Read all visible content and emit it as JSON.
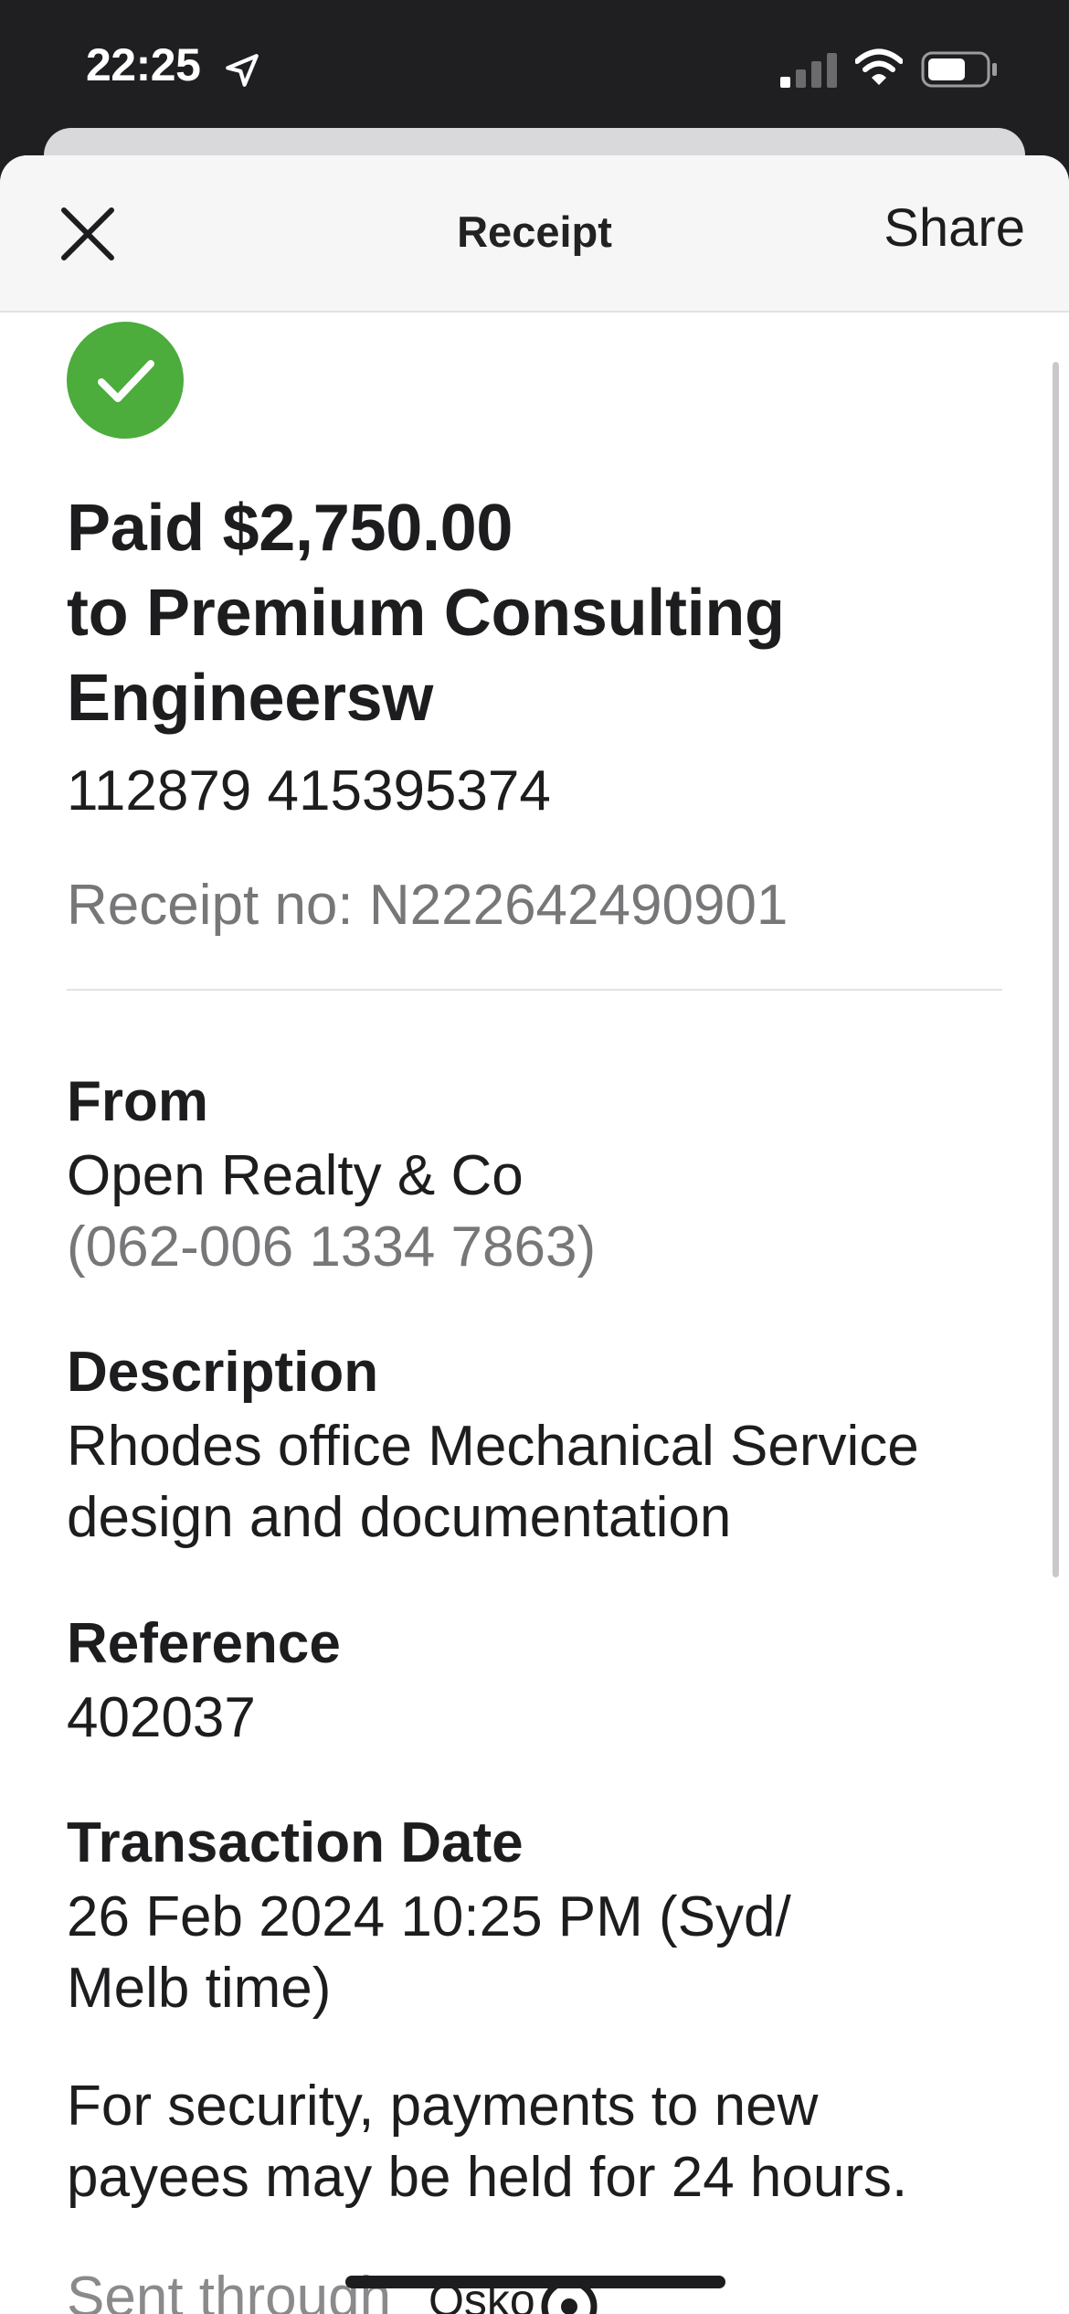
{
  "status_bar": {
    "time": "22:25"
  },
  "nav": {
    "title": "Receipt",
    "share_label": "Share"
  },
  "receipt": {
    "headline_line1": "Paid $2,750.00",
    "headline_line2": "to Premium Consulting",
    "headline_line3": "Engineersw",
    "account_number": "112879 415395374",
    "receipt_no": "Receipt no: N222642490901"
  },
  "from": {
    "label": "From",
    "name": "Open Realty & Co",
    "account": "(062-006 1334 7863)"
  },
  "description": {
    "label": "Description",
    "line1": "Rhodes office Mechanical Service",
    "line2": "design and documentation"
  },
  "reference": {
    "label": "Reference",
    "value": "402037"
  },
  "transaction_date": {
    "label": "Transaction Date",
    "line1": "26 Feb 2024 10:25 PM (Syd/",
    "line2": "Melb time)"
  },
  "security_note": {
    "line1": "For security, payments to new",
    "line2": "payees may be held for 24 hours."
  },
  "footer": {
    "sent_through": "Sent through",
    "logo_text": "Osko"
  },
  "colors": {
    "success_green": "#4cac3c",
    "muted_text": "#77777a",
    "status_bar_bg": "#1f1e21"
  }
}
